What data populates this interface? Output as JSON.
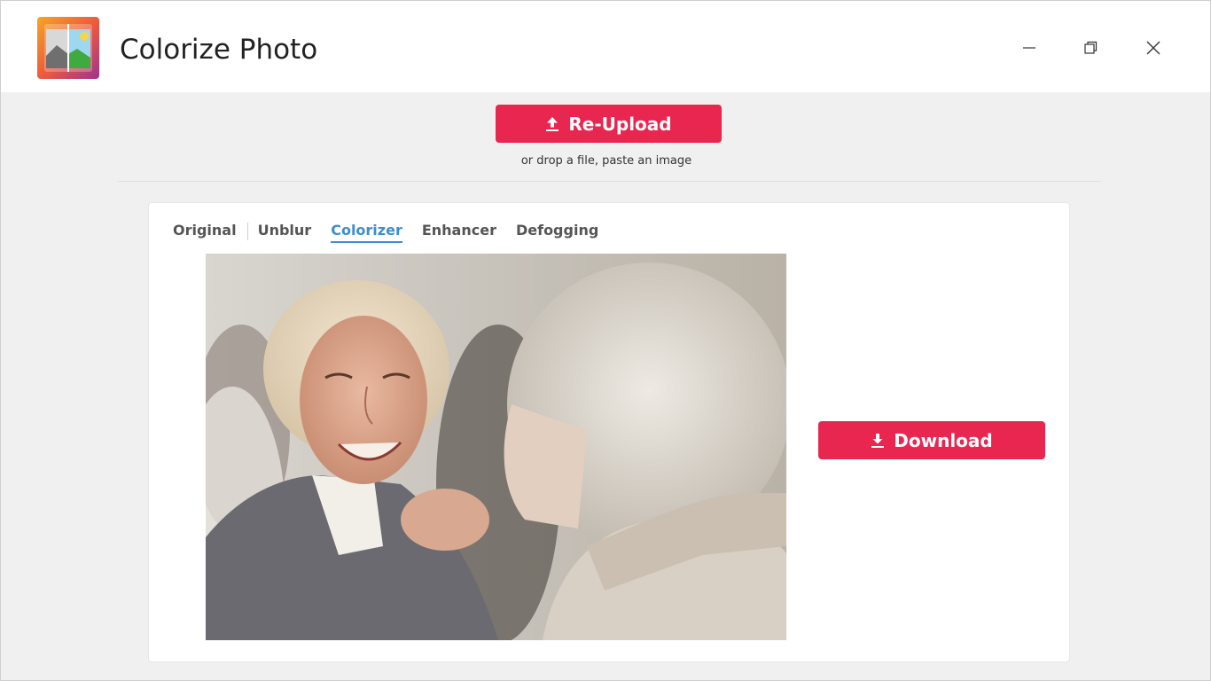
{
  "app": {
    "title": "Colorize Photo",
    "icon": "landscape-photo-icon"
  },
  "window_controls": {
    "minimize_icon": "minimize-icon",
    "maximize_icon": "restore-icon",
    "close_icon": "close-icon"
  },
  "upload": {
    "button_label": "Re-Upload",
    "button_icon": "upload-arrow-icon",
    "hint": "or drop a file, paste an image"
  },
  "tabs": [
    {
      "label": "Original",
      "active": false
    },
    {
      "label": "Unblur",
      "active": false
    },
    {
      "label": "Colorizer",
      "active": true
    },
    {
      "label": "Enhancer",
      "active": false
    },
    {
      "label": "Defogging",
      "active": false
    }
  ],
  "result": {
    "download_label": "Download",
    "download_icon": "download-arrow-icon"
  },
  "colors": {
    "accent": "#e8264f",
    "active_tab": "#3e8ed0",
    "background": "#f0f0f0"
  }
}
